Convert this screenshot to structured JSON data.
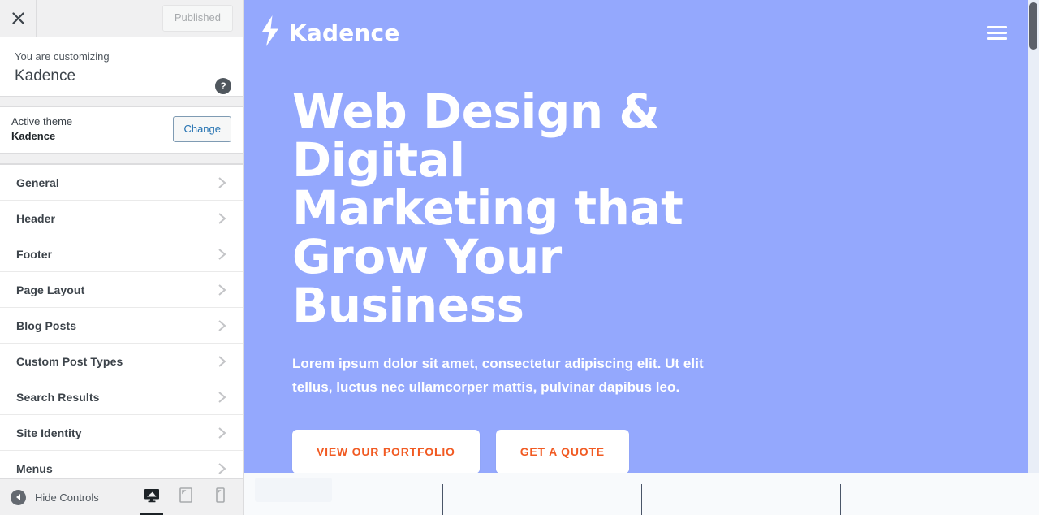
{
  "customizer": {
    "close_icon": "close-icon",
    "publish_label": "Published",
    "customizing_label": "You are customizing",
    "site_title": "Kadence",
    "help_icon": "?",
    "theme": {
      "active_label": "Active theme",
      "name": "Kadence",
      "change_label": "Change"
    },
    "sections": [
      {
        "label": "General"
      },
      {
        "label": "Header"
      },
      {
        "label": "Footer"
      },
      {
        "label": "Page Layout"
      },
      {
        "label": "Blog Posts"
      },
      {
        "label": "Custom Post Types"
      },
      {
        "label": "Search Results"
      },
      {
        "label": "Site Identity"
      },
      {
        "label": "Menus"
      }
    ],
    "footer": {
      "hide_controls_label": "Hide Controls",
      "devices": [
        {
          "name": "desktop",
          "active": true
        },
        {
          "name": "tablet",
          "active": false
        },
        {
          "name": "mobile",
          "active": false
        }
      ]
    }
  },
  "preview": {
    "header": {
      "brand_name": "Kadence",
      "logo_icon": "lightning-bolt-icon",
      "menu_icon": "hamburger-menu-icon"
    },
    "hero": {
      "title": "Web Design & Digital Marketing that Grow Your Business",
      "subtitle": "Lorem ipsum dolor sit amet, consectetur adipiscing elit. Ut elit tellus, luctus nec ullamcorper mattis, pulvinar dapibus leo.",
      "primary_button": "VIEW OUR PORTFOLIO",
      "secondary_button": "GET A QUOTE"
    }
  },
  "colors": {
    "hero_background": "#94a8fd",
    "button_text": "#f15a22",
    "sidebar_background": "#ffffff",
    "topbar_background": "#f0f0f1",
    "link_blue": "#2271b1",
    "section_background": "#f8fafc"
  }
}
